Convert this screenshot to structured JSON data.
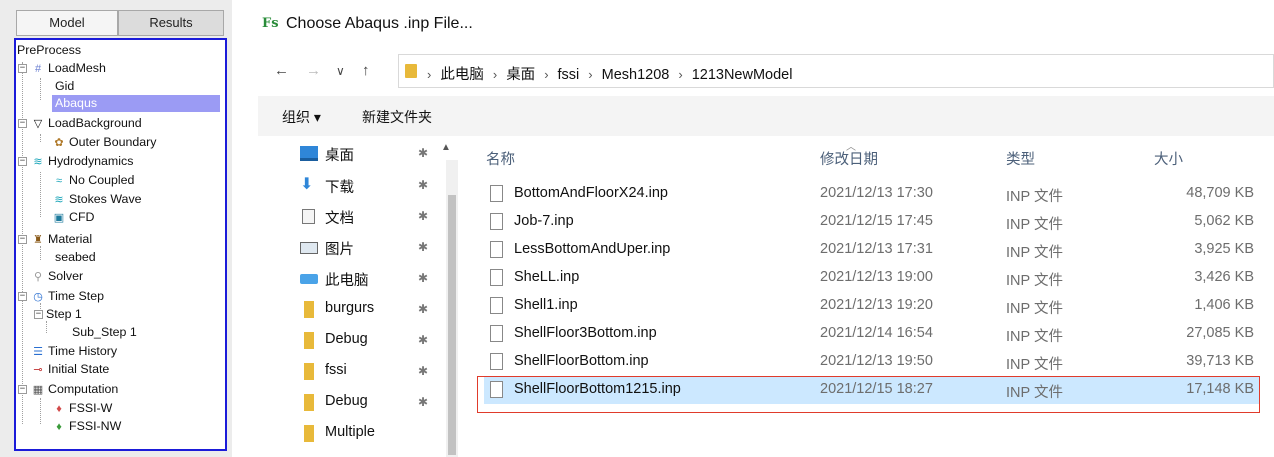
{
  "left_panel": {
    "tabs": [
      {
        "label": "Model",
        "active": true
      },
      {
        "label": "Results",
        "active": false
      }
    ],
    "tree": {
      "preprocess": "PreProcess",
      "loadmesh": "LoadMesh",
      "gid": "Gid",
      "abaqus": "Abaqus",
      "loadbackground": "LoadBackground",
      "outer_boundary": "Outer Boundary",
      "hydrodynamics": "Hydrodynamics",
      "no_coupled": "No Coupled",
      "stokes_wave": "Stokes Wave",
      "cfd": "CFD",
      "material": "Material",
      "seabed": "seabed",
      "solver": "Solver",
      "time_step": "Time Step",
      "step1": "Step 1",
      "sub_step1": "Sub_Step 1",
      "time_history": "Time History",
      "initial_state": "Initial State",
      "computation": "Computation",
      "fssi_w": "FSSI-W",
      "fssi_nw": "FSSI-NW"
    },
    "selected_item": "Abaqus",
    "colors": {
      "selection": "#9b9bf4",
      "tree_border": "#1b1bd9"
    }
  },
  "dialog": {
    "app_logo": "Fs",
    "title": "Choose Abaqus .inp File...",
    "nav": {
      "back": "←",
      "forward": "→",
      "recent": "∨",
      "up": "↑"
    },
    "breadcrumb": [
      "此电脑",
      "桌面",
      "fssi",
      "Mesh1208",
      "1213NewModel"
    ],
    "breadcrumb_sep": "›",
    "commands": {
      "organize": "组织 ▾",
      "new_folder": "新建文件夹"
    },
    "nav_pane": [
      {
        "label": "桌面",
        "icon": "desktop-icon",
        "pinned": true
      },
      {
        "label": "下载",
        "icon": "download-icon",
        "pinned": true
      },
      {
        "label": "文档",
        "icon": "document-icon",
        "pinned": true
      },
      {
        "label": "图片",
        "icon": "picture-icon",
        "pinned": true
      },
      {
        "label": "此电脑",
        "icon": "computer-icon",
        "pinned": true
      },
      {
        "label": "burgurs",
        "icon": "folder-icon",
        "pinned": true
      },
      {
        "label": "Debug",
        "icon": "folder-icon",
        "pinned": true
      },
      {
        "label": "fssi",
        "icon": "folder-icon",
        "pinned": true
      },
      {
        "label": "Debug",
        "icon": "folder-icon",
        "pinned": true
      },
      {
        "label": "Multiple",
        "icon": "folder-icon",
        "pinned": false
      }
    ],
    "pin_glyph": "✱",
    "columns": {
      "name": "名称",
      "date": "修改日期",
      "type": "类型",
      "size": "大小"
    },
    "files": [
      {
        "name": "BottomAndFloorX24.inp",
        "date": "2021/12/13 17:30",
        "type": "INP 文件",
        "size": "48,709 KB"
      },
      {
        "name": "Job-7.inp",
        "date": "2021/12/15 17:45",
        "type": "INP 文件",
        "size": "5,062 KB"
      },
      {
        "name": "LessBottomAndUper.inp",
        "date": "2021/12/13 17:31",
        "type": "INP 文件",
        "size": "3,925 KB"
      },
      {
        "name": "SheLL.inp",
        "date": "2021/12/13 19:00",
        "type": "INP 文件",
        "size": "3,426 KB"
      },
      {
        "name": "Shell1.inp",
        "date": "2021/12/13 19:20",
        "type": "INP 文件",
        "size": "1,406 KB"
      },
      {
        "name": "ShellFloor3Bottom.inp",
        "date": "2021/12/14 16:54",
        "type": "INP 文件",
        "size": "27,085 KB"
      },
      {
        "name": "ShellFloorBottom.inp",
        "date": "2021/12/13 19:50",
        "type": "INP 文件",
        "size": "39,713 KB"
      },
      {
        "name": "ShellFloorBottom1215.inp",
        "date": "2021/12/15 18:27",
        "type": "INP 文件",
        "size": "17,148 KB"
      }
    ],
    "selected_file": "ShellFloorBottom1215.inp",
    "colors": {
      "selected_row": "#cce8ff",
      "highlight_box": "#e03b2b",
      "folder": "#e8b93a"
    }
  }
}
